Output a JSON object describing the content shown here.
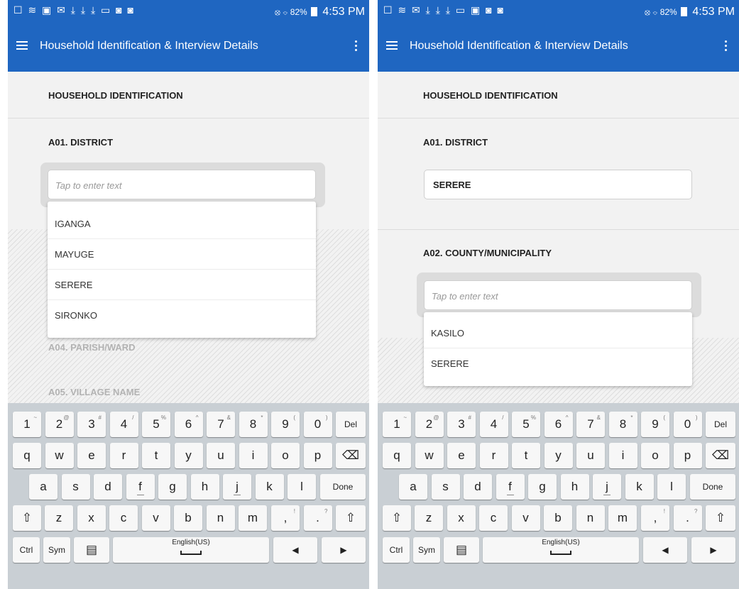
{
  "screens": [
    {
      "status": {
        "icons": "☐ ≋ ▣ ✉ ⤓ ⤓ ⤓ ▭ ◙ ◙",
        "right_icons": "⦻ ⌔",
        "battery": "82%",
        "time": "4:53 PM"
      },
      "appbar": {
        "title": "Household Identification & Interview Details"
      },
      "section_title": "HOUSEHOLD IDENTIFICATION",
      "district_label": "A01. DISTRICT",
      "input_placeholder": "Tap to enter text",
      "dropdown_options": [
        "IGANGA",
        "MAYUGE",
        "SERERE",
        "SIRONKO"
      ],
      "faded_labels": [
        "A04. PARISH/WARD",
        "A05. VILLAGE NAME"
      ]
    },
    {
      "status": {
        "icons": "☐ ≋ ✉ ⤓ ⤓ ⤓ ▭ ▣ ◙ ◙",
        "right_icons": "⦻ ⌔",
        "battery": "82%",
        "time": "4:53 PM"
      },
      "appbar": {
        "title": "Household Identification & Interview Details"
      },
      "section_title": "HOUSEHOLD IDENTIFICATION",
      "district_label": "A01. DISTRICT",
      "district_value": "SERERE",
      "county_label": "A02. COUNTY/MUNICIPALITY",
      "input_placeholder": "Tap to enter text",
      "dropdown_options": [
        "KASILO",
        "SERERE"
      ]
    }
  ],
  "keyboard": {
    "row1": [
      {
        "k": "1",
        "s": "~"
      },
      {
        "k": "2",
        "s": "@"
      },
      {
        "k": "3",
        "s": "#"
      },
      {
        "k": "4",
        "s": "/"
      },
      {
        "k": "5",
        "s": "%"
      },
      {
        "k": "6",
        "s": "^"
      },
      {
        "k": "7",
        "s": "&"
      },
      {
        "k": "8",
        "s": "*"
      },
      {
        "k": "9",
        "s": "("
      },
      {
        "k": "0",
        "s": ")"
      },
      {
        "k": "Del",
        "s": ""
      }
    ],
    "row2": [
      "q",
      "w",
      "e",
      "r",
      "t",
      "y",
      "u",
      "i",
      "o",
      "p"
    ],
    "row3": [
      "a",
      "s",
      "d",
      "f",
      "g",
      "h",
      "j",
      "k",
      "l"
    ],
    "row4": [
      "z",
      "x",
      "c",
      "v",
      "b",
      "n",
      "m"
    ],
    "row4_punct": [
      {
        "k": ",",
        "s": "!"
      },
      {
        "k": ".",
        "s": "?"
      }
    ],
    "done": "Done",
    "ctrl": "Ctrl",
    "sym": "Sym",
    "clipboard_icon": "▤",
    "space_label": "English(US)",
    "backspace_icon": "⌫",
    "shift_icon": "⇧",
    "left_arrow": "◀",
    "right_arrow": "▶"
  }
}
